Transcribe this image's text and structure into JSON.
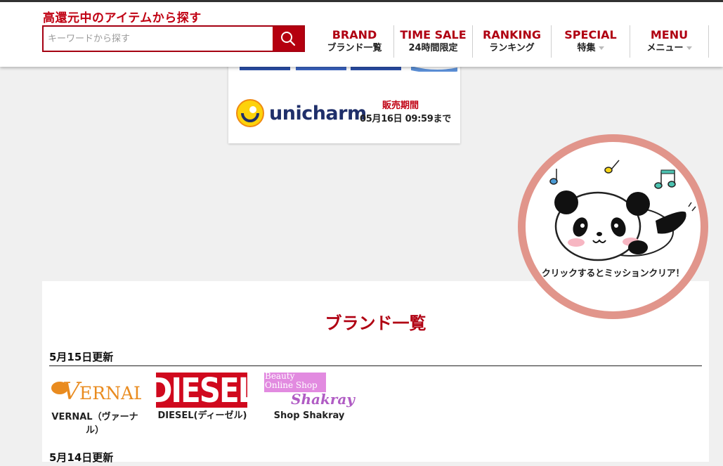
{
  "header": {
    "tagline": "高還元中のアイテムから探す",
    "search_placeholder": "キーワードから探す",
    "nav": [
      {
        "en": "BRAND",
        "jp": "ブランド一覧"
      },
      {
        "en": "TIME SALE",
        "jp": "24時間限定"
      },
      {
        "en": "RANKING",
        "jp": "ランキング"
      },
      {
        "en": "SPECIAL",
        "jp": "特集"
      },
      {
        "en": "MENU",
        "jp": "メニュー"
      }
    ]
  },
  "sale_card": {
    "brand_logo_text": "unicharm",
    "sale_label": "販売期間",
    "sale_until": "05月16日 09:59まで"
  },
  "mission": {
    "text": "クリックするとミッションクリア！"
  },
  "brand_list": {
    "title": "ブランド一覧",
    "groups": [
      {
        "date": "5月15日更新",
        "brands": [
          {
            "name": "VERNAL（ヴァーナル）",
            "logo": "VERNAL"
          },
          {
            "name": "DIESEL(ディーゼル)",
            "logo": "DIESEL"
          },
          {
            "name": "Shop Shakray",
            "logo_line1": "Beauty",
            "logo_line2": "Online Shop",
            "logo_script": "Shakray"
          }
        ]
      },
      {
        "date": "5月14日更新",
        "brands": []
      }
    ]
  },
  "colors": {
    "brand_red": "#b00012",
    "mission_ring": "#e1958b"
  }
}
